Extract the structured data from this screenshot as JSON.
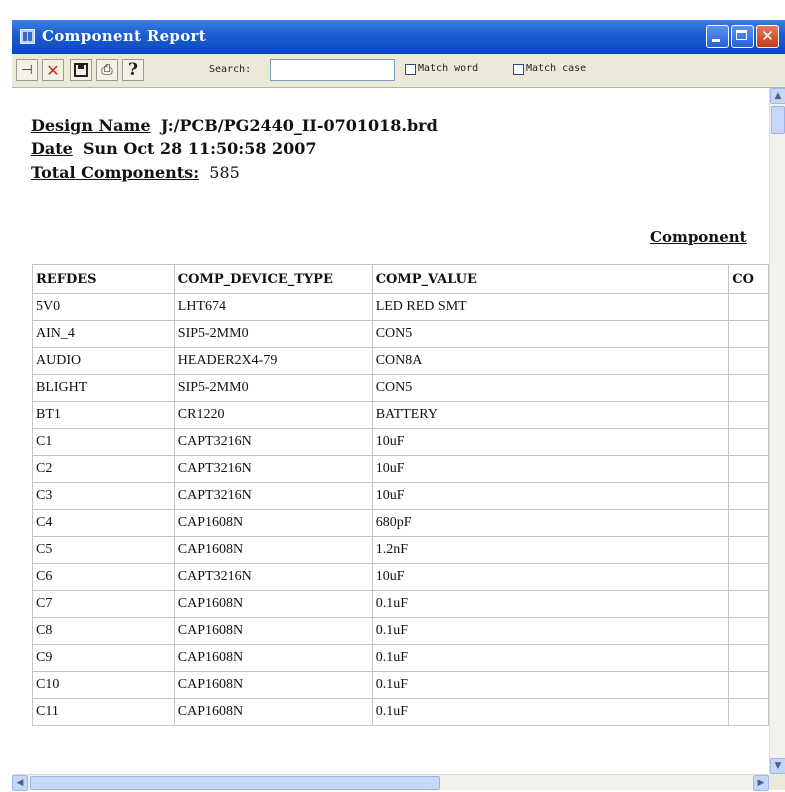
{
  "window": {
    "title": "Component Report",
    "min_icon": "minimize-icon",
    "max_icon": "maximize-icon",
    "close_icon": "close-icon",
    "title_bar_color": "#1d5fd1"
  },
  "toolbar": {
    "search_label": "Search:",
    "search_value": "",
    "match_word_label": "Match word",
    "match_case_label": "Match case",
    "match_word_checked": false,
    "match_case_checked": false,
    "icons": [
      "pin-icon",
      "delete-icon",
      "save-icon",
      "print-icon",
      "help-icon"
    ]
  },
  "report": {
    "design_name_label": "Design Name",
    "design_name_value": "J:/PCB/PG2440_II-0701018.brd",
    "date_label": "Date",
    "date_value": "Sun Oct 28 11:50:58 2007",
    "total_label": "Total Components:",
    "total_value": "585",
    "section_title": "Component",
    "columns": [
      "REFDES",
      "COMP_DEVICE_TYPE",
      "COMP_VALUE",
      "CO"
    ],
    "rows": [
      [
        "5V0",
        "LHT674",
        "LED RED SMT",
        ""
      ],
      [
        "AIN_4",
        "SIP5-2MM0",
        "CON5",
        ""
      ],
      [
        "AUDIO",
        "HEADER2X4-79",
        "CON8A",
        ""
      ],
      [
        "BLIGHT",
        "SIP5-2MM0",
        "CON5",
        ""
      ],
      [
        "BT1",
        "CR1220",
        "BATTERY",
        ""
      ],
      [
        "C1",
        "CAPT3216N",
        "10uF",
        ""
      ],
      [
        "C2",
        "CAPT3216N",
        "10uF",
        ""
      ],
      [
        "C3",
        "CAPT3216N",
        "10uF",
        ""
      ],
      [
        "C4",
        "CAP1608N",
        "680pF",
        ""
      ],
      [
        "C5",
        "CAP1608N",
        "1.2nF",
        ""
      ],
      [
        "C6",
        "CAPT3216N",
        "10uF",
        ""
      ],
      [
        "C7",
        "CAP1608N",
        "0.1uF",
        ""
      ],
      [
        "C8",
        "CAP1608N",
        "0.1uF",
        ""
      ],
      [
        "C9",
        "CAP1608N",
        "0.1uF",
        ""
      ],
      [
        "C10",
        "CAP1608N",
        "0.1uF",
        ""
      ],
      [
        "C11",
        "CAP1608N",
        "0.1uF",
        ""
      ]
    ]
  },
  "scrollbars": {
    "vertical_icons": [
      "scroll-up-icon",
      "scroll-down-icon"
    ],
    "horizontal_icons": [
      "scroll-left-icon",
      "scroll-right-icon"
    ]
  }
}
